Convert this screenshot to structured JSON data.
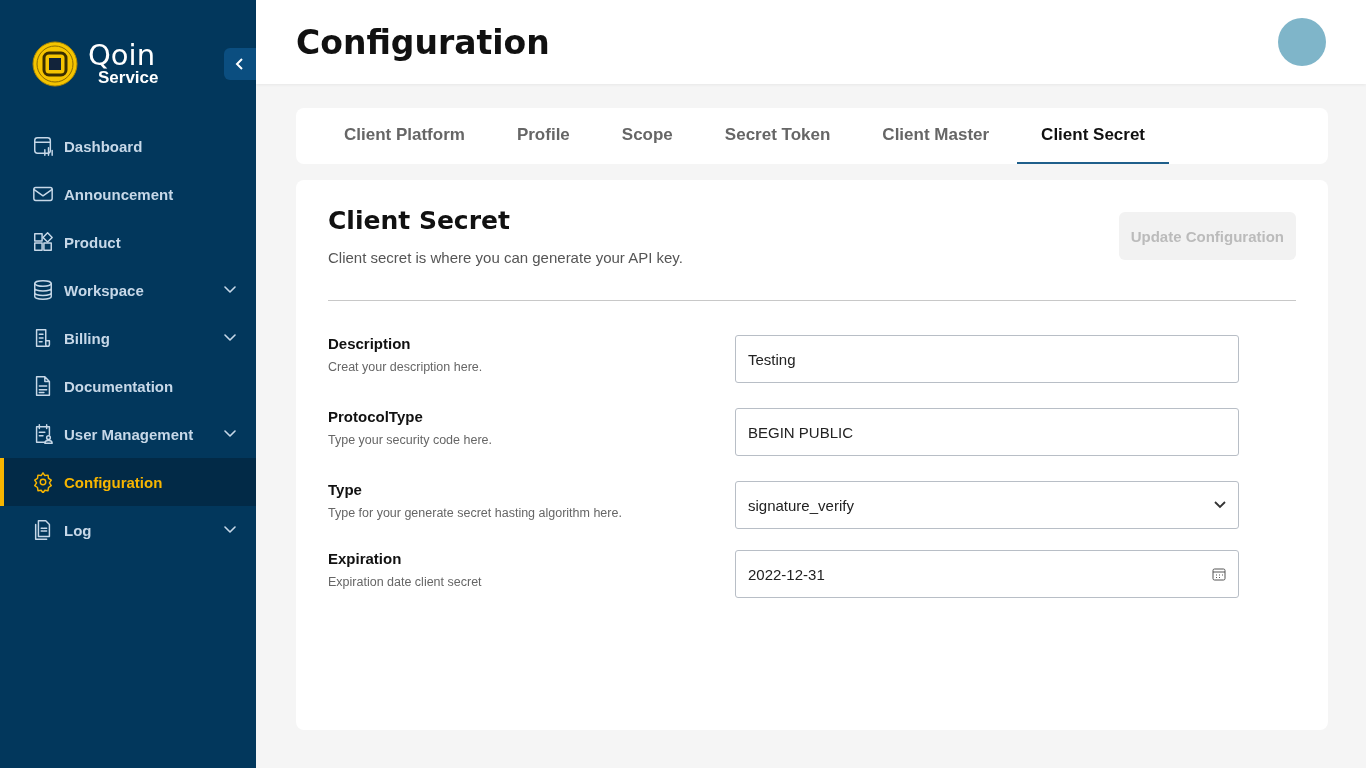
{
  "sidebar": {
    "logo": {
      "title": "Qoin",
      "subtitle": "Service"
    },
    "items": [
      {
        "label": "Dashboard",
        "expandable": false,
        "selected": false
      },
      {
        "label": "Announcement",
        "expandable": false,
        "selected": false
      },
      {
        "label": "Product",
        "expandable": false,
        "selected": false
      },
      {
        "label": "Workspace",
        "expandable": true,
        "selected": false
      },
      {
        "label": "Billing",
        "expandable": true,
        "selected": false
      },
      {
        "label": "Documentation",
        "expandable": false,
        "selected": false
      },
      {
        "label": "User Management",
        "expandable": true,
        "selected": false
      },
      {
        "label": "Configuration",
        "expandable": false,
        "selected": true
      },
      {
        "label": "Log",
        "expandable": true,
        "selected": false
      }
    ]
  },
  "header": {
    "title": "Configuration"
  },
  "tabs": [
    {
      "label": "Client Platform",
      "selected": false
    },
    {
      "label": "Profile",
      "selected": false
    },
    {
      "label": "Scope",
      "selected": false
    },
    {
      "label": "Secret Token",
      "selected": false
    },
    {
      "label": "Client Master",
      "selected": false
    },
    {
      "label": "Client Secret",
      "selected": true
    }
  ],
  "card": {
    "title": "Client Secret",
    "subtitle": "Client secret is where you can generate your API key.",
    "button": {
      "label": "Update Configuration",
      "disabled": true
    },
    "fields": [
      {
        "kind": "text",
        "label": "Description",
        "hint": "Creat your description here.",
        "value": "Testing"
      },
      {
        "kind": "text",
        "label": "ProtocolType",
        "hint": "Type your security code here.",
        "value": "BEGIN PUBLIC"
      },
      {
        "kind": "select",
        "label": "Type",
        "hint": "Type for your  generate secret hasting algorithm here.",
        "value": "signature_verify"
      },
      {
        "kind": "date",
        "label": "Expiration",
        "hint": "Expiration date client secret",
        "value": "2022-12-31"
      }
    ]
  }
}
